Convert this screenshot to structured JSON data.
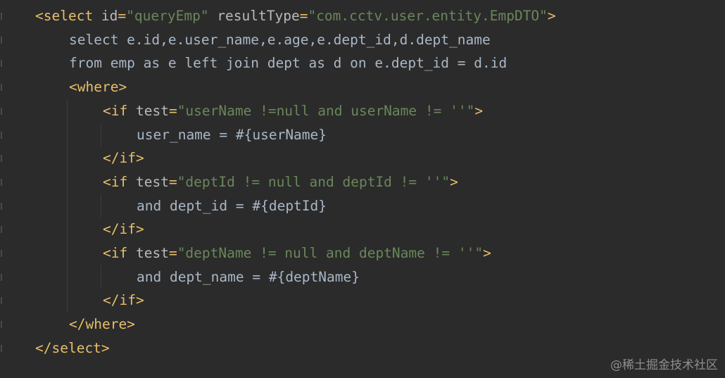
{
  "code": {
    "lines": [
      {
        "indent": 0,
        "tokens": [
          {
            "t": "tag",
            "v": "<select "
          },
          {
            "t": "attr",
            "v": "id"
          },
          {
            "t": "tag",
            "v": "="
          },
          {
            "t": "val",
            "v": "\"queryEmp\""
          },
          {
            "t": "attr",
            "v": " resultType"
          },
          {
            "t": "tag",
            "v": "="
          },
          {
            "t": "val",
            "v": "\"com.cctv.user.entity.EmpDTO\""
          },
          {
            "t": "tag",
            "v": ">"
          }
        ]
      },
      {
        "indent": 1,
        "tokens": [
          {
            "t": "text",
            "v": "select e.id,e.user_name,e.age,e.dept_id,d.dept_name"
          }
        ]
      },
      {
        "indent": 1,
        "tokens": [
          {
            "t": "text",
            "v": "from emp as e left join dept as d on e.dept_id = d.id"
          }
        ]
      },
      {
        "indent": 1,
        "tokens": [
          {
            "t": "tag",
            "v": "<where>"
          }
        ]
      },
      {
        "indent": 2,
        "tokens": [
          {
            "t": "tag",
            "v": "<if "
          },
          {
            "t": "attr",
            "v": "test"
          },
          {
            "t": "tag",
            "v": "="
          },
          {
            "t": "val",
            "v": "\"userName !=null and userName != ''\""
          },
          {
            "t": "tag",
            "v": ">"
          }
        ]
      },
      {
        "indent": 3,
        "tokens": [
          {
            "t": "text",
            "v": "user_name = #{userName}"
          }
        ]
      },
      {
        "indent": 2,
        "tokens": [
          {
            "t": "tag",
            "v": "</if>"
          }
        ]
      },
      {
        "indent": 2,
        "tokens": [
          {
            "t": "tag",
            "v": "<if "
          },
          {
            "t": "attr",
            "v": "test"
          },
          {
            "t": "tag",
            "v": "="
          },
          {
            "t": "val",
            "v": "\"deptId != null and deptId != ''\""
          },
          {
            "t": "tag",
            "v": ">"
          }
        ]
      },
      {
        "indent": 3,
        "tokens": [
          {
            "t": "text",
            "v": "and dept_id = #{deptId}"
          }
        ]
      },
      {
        "indent": 2,
        "tokens": [
          {
            "t": "tag",
            "v": "</if>"
          }
        ]
      },
      {
        "indent": 2,
        "tokens": [
          {
            "t": "tag",
            "v": "<if "
          },
          {
            "t": "attr",
            "v": "test"
          },
          {
            "t": "tag",
            "v": "="
          },
          {
            "t": "val",
            "v": "\"deptName != null and deptName != ''\""
          },
          {
            "t": "tag",
            "v": ">"
          }
        ]
      },
      {
        "indent": 3,
        "tokens": [
          {
            "t": "text",
            "v": "and dept_name = #{deptName}"
          }
        ]
      },
      {
        "indent": 2,
        "tokens": [
          {
            "t": "tag",
            "v": "</if>"
          }
        ]
      },
      {
        "indent": 1,
        "tokens": [
          {
            "t": "tag",
            "v": "</where>"
          }
        ]
      },
      {
        "indent": 0,
        "tokens": [
          {
            "t": "tag",
            "v": "</select>"
          }
        ]
      }
    ]
  },
  "colors": {
    "background": "#2b2b2b",
    "tag": "#e8bf6a",
    "attribute": "#bababa",
    "string": "#6a8759",
    "text": "#a9b7c6"
  },
  "watermark": "@稀土掘金技术社区"
}
